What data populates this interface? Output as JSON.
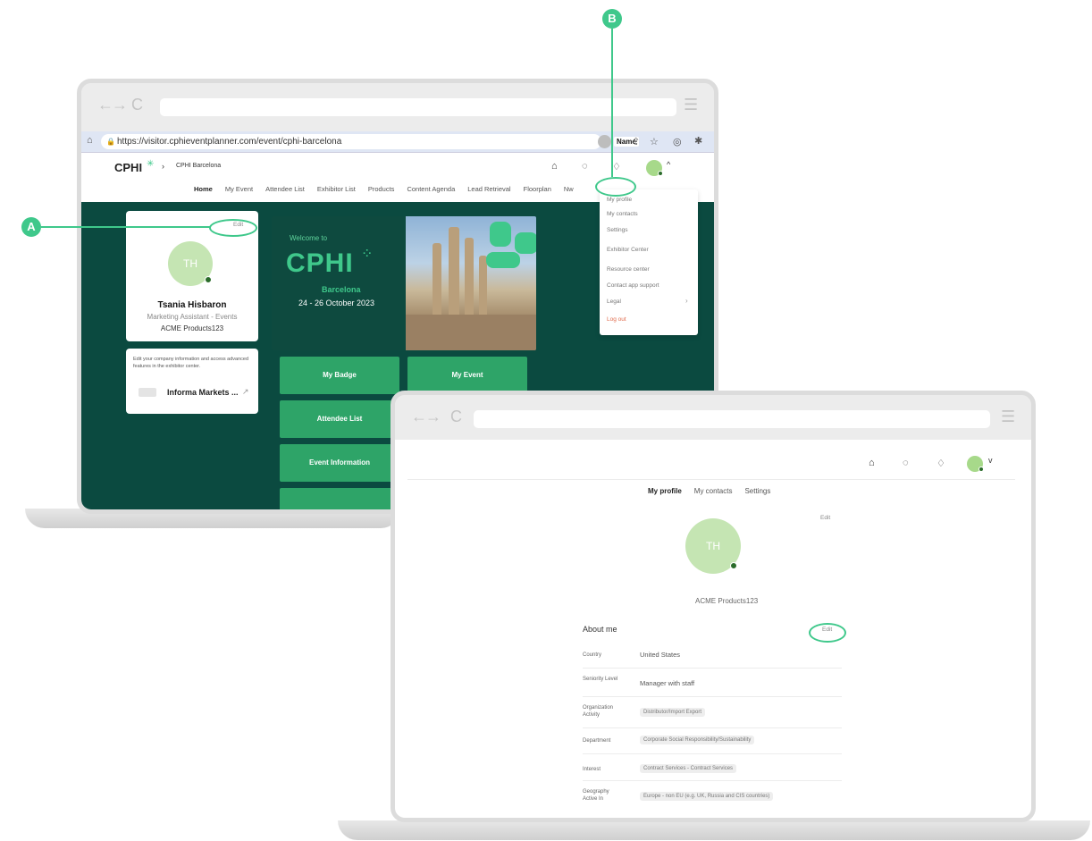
{
  "annotations": {
    "a": "A",
    "b": "B"
  },
  "name_tooltip": "Name",
  "laptop1": {
    "url": "https://visitor.cphieventplanner.com/event/cphi-barcelona",
    "logo": "CPHI",
    "breadcrumb": "CPHI Barcelona",
    "nav": [
      "Home",
      "My Event",
      "Attendee List",
      "Exhibitor List",
      "Products",
      "Content Agenda",
      "Lead Retrieval",
      "Floorplan",
      "Nw"
    ],
    "profile": {
      "edit": "Edit",
      "initials": "TH",
      "name": "Tsania Hisbaron",
      "title": "Marketing Assistant - Events",
      "company": "ACME Products123"
    },
    "exhibitor_card": {
      "text": "Edit your company information and access advanced features in the exhibitor center.",
      "company": "Informa Markets ..."
    },
    "banner": {
      "welcome": "Welcome to",
      "brand": "CPHI",
      "city": "Barcelona",
      "dates": "24 - 26 October 2023"
    },
    "tiles": [
      "My Badge",
      "My Event",
      "Attendee List",
      "Event Information"
    ],
    "dropdown": [
      "My profile",
      "My contacts",
      "Settings",
      "Exhibitor Center",
      "Resource center",
      "Contact app support",
      "Legal",
      "Log out"
    ]
  },
  "laptop2": {
    "tabs": [
      "My profile",
      "My contacts",
      "Settings"
    ],
    "edit_top": "Edit",
    "initials": "TH",
    "company": "ACME Products123",
    "about_title": "About me",
    "about_edit": "Edit",
    "fields": [
      {
        "label": "Country",
        "value": "United States",
        "chips": []
      },
      {
        "label": "Seniority Level",
        "value": "Manager with staff",
        "chips": []
      },
      {
        "label": "Organization Activity",
        "value": "",
        "chips": [
          "Distributor/Import Export"
        ]
      },
      {
        "label": "Department",
        "value": "",
        "chips": [
          "Corporate Social Responsibility/Sustainability"
        ]
      },
      {
        "label": "Interest",
        "value": "",
        "chips": [
          "Contract Services - Contract Services"
        ]
      },
      {
        "label": "Geography Active In",
        "value": "",
        "chips": [
          "Europe - non EU (e.g. UK, Russia and CIS countries)"
        ]
      }
    ]
  },
  "colors": {
    "accent": "#3fc88b",
    "teal": "#0b4a40",
    "tile": "#2ea468"
  }
}
